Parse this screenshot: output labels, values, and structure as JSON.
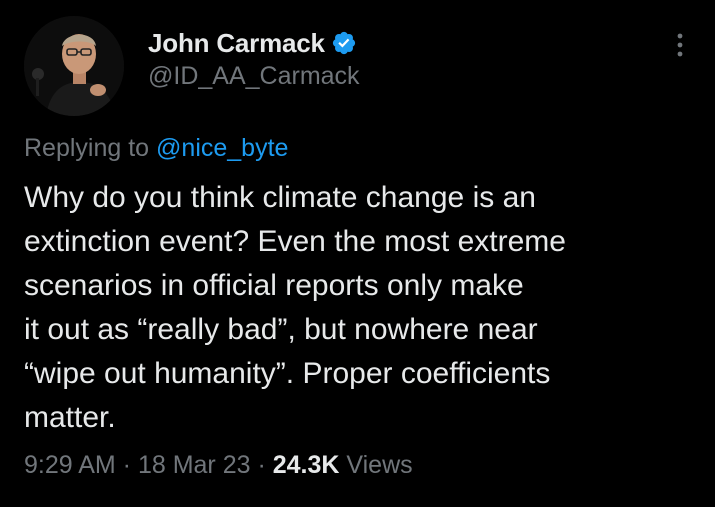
{
  "author": {
    "display_name": "John Carmack",
    "handle": "@ID_AA_Carmack",
    "verified": true
  },
  "reply": {
    "prefix": "Replying to ",
    "mention": "@nice_byte"
  },
  "body": {
    "lines": [
      "Why do you think climate change is an",
      "extinction event? Even the most extreme",
      "scenarios in official reports only make",
      "it out as “really bad”, but nowhere near",
      "“wipe out humanity”. Proper coefficients",
      "matter."
    ]
  },
  "meta": {
    "time": "9:29 AM",
    "separator": " · ",
    "date": "18 Mar 23",
    "views_count": "24.3K",
    "views_label": "Views"
  },
  "colors": {
    "background": "#000000",
    "primary_text": "#e7e9ea",
    "secondary_text": "#71767b",
    "accent": "#1d9bf0"
  },
  "icons": {
    "verified": "verified-badge-icon",
    "more": "more-vertical-icon"
  }
}
